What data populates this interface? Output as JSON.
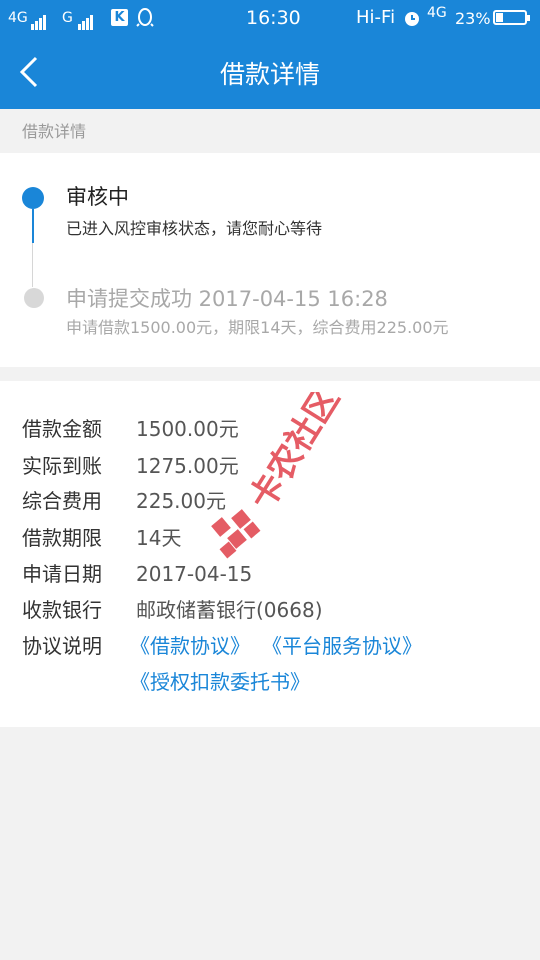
{
  "status_bar": {
    "net1": "4G",
    "net2": "G",
    "time": "16:30",
    "wifi": "Hi-Fi",
    "net3": "4G",
    "battery": "23%"
  },
  "nav": {
    "title": "借款详情"
  },
  "section_header": "借款详情",
  "timeline": [
    {
      "title": "审核中",
      "desc": "已进入风控审核状态，请您耐心等待"
    },
    {
      "title": "申请提交成功 2017-04-15 16:28",
      "desc": "申请借款1500.00元，期限14天，综合费用225.00元"
    }
  ],
  "details": [
    {
      "label": "借款金额",
      "value": "1500.00元"
    },
    {
      "label": "实际到账",
      "value": "1275.00元"
    },
    {
      "label": "综合费用",
      "value": "225.00元"
    },
    {
      "label": "借款期限",
      "value": "14天"
    },
    {
      "label": "申请日期",
      "value": "2017-04-15"
    },
    {
      "label": "收款银行",
      "value": "邮政储蓄银行(0668)"
    },
    {
      "label": "协议说明",
      "value": ""
    }
  ],
  "agreements": [
    "《借款协议》",
    "《平台服务协议》",
    "《授权扣款委托书》"
  ],
  "watermark_text": "卡农社区",
  "colors": {
    "brand": "#1a86d8",
    "watermark": "#e0404a"
  }
}
